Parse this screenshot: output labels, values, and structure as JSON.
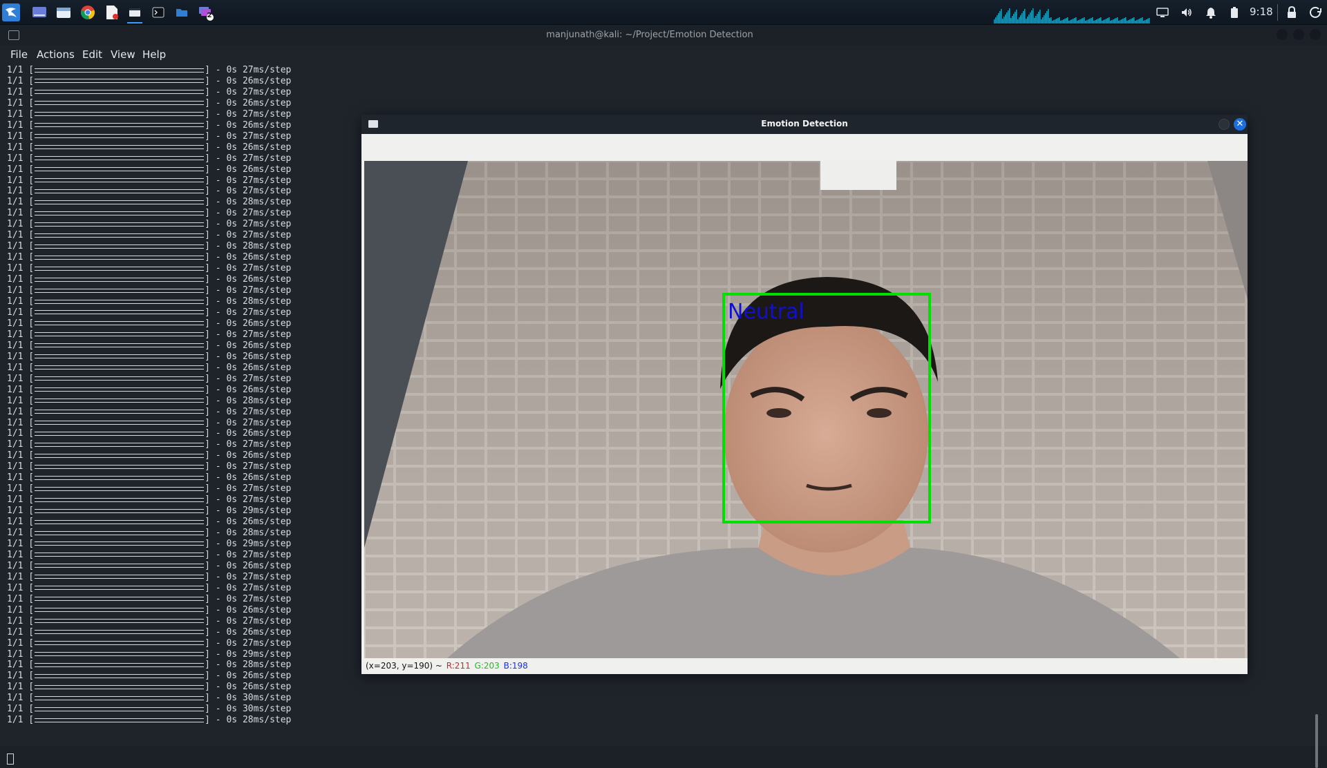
{
  "taskbar": {
    "clock": "9:18",
    "app_icons": [
      "kali-menu-icon",
      "workspace-icon",
      "file-manager-icon",
      "chrome-icon",
      "text-editor-icon",
      "terminal-window-icon",
      "terminal-icon",
      "folder-icon",
      "window-switcher-icon"
    ],
    "window_count_badge": "2"
  },
  "terminal": {
    "title": "manjunath@kali: ~/Project/Emotion Detection",
    "menu": [
      "File",
      "Actions",
      "Edit",
      "View",
      "Help"
    ],
    "lines": [
      "27ms/step",
      "26ms/step",
      "27ms/step",
      "26ms/step",
      "27ms/step",
      "26ms/step",
      "27ms/step",
      "26ms/step",
      "27ms/step",
      "26ms/step",
      "27ms/step",
      "27ms/step",
      "28ms/step",
      "27ms/step",
      "27ms/step",
      "27ms/step",
      "28ms/step",
      "26ms/step",
      "27ms/step",
      "26ms/step",
      "27ms/step",
      "28ms/step",
      "27ms/step",
      "26ms/step",
      "27ms/step",
      "26ms/step",
      "26ms/step",
      "26ms/step",
      "27ms/step",
      "26ms/step",
      "28ms/step",
      "27ms/step",
      "27ms/step",
      "26ms/step",
      "27ms/step",
      "26ms/step",
      "27ms/step",
      "26ms/step",
      "27ms/step",
      "27ms/step",
      "29ms/step",
      "26ms/step",
      "28ms/step",
      "29ms/step",
      "27ms/step",
      "26ms/step",
      "27ms/step",
      "27ms/step",
      "27ms/step",
      "26ms/step",
      "27ms/step",
      "26ms/step",
      "27ms/step",
      "29ms/step",
      "28ms/step",
      "26ms/step",
      "26ms/step",
      "30ms/step",
      "30ms/step",
      "28ms/step"
    ],
    "line_prefix": "1/1 [",
    "line_middle": "] - 0s "
  },
  "emotion_window": {
    "title": "Emotion Detection",
    "close_label": "✕",
    "emotion_label": "Neutral",
    "status_coords": "(x=203, y=190) ~ ",
    "status_r": "R:211",
    "status_g": "G:203",
    "status_b": "B:198"
  },
  "colors": {
    "box": "#00e000",
    "label": "#1010d0",
    "accent": "#1d6fe0",
    "graph": "#19a8c8"
  }
}
